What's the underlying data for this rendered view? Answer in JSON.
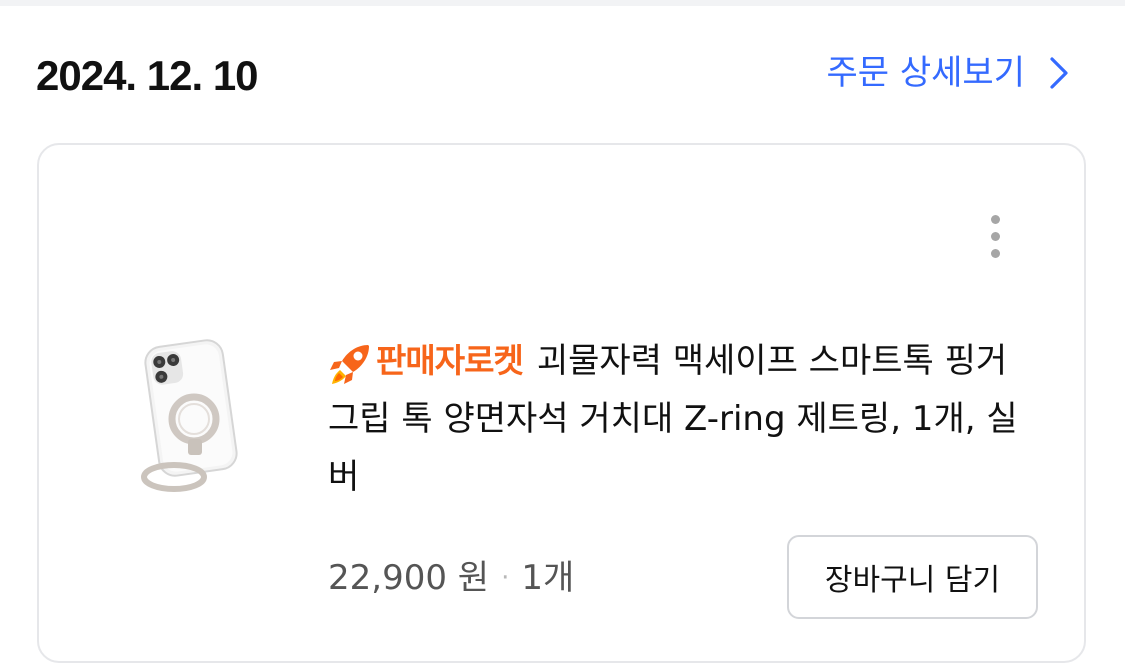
{
  "order": {
    "date": "2024. 12. 10",
    "detail_link_label": "주문 상세보기",
    "link_color": "#346aff"
  },
  "product": {
    "badge_label": "판매자로켓",
    "badge_color": "#f7651a",
    "badge_icon": "rocket-icon",
    "title": "괴물자력 맥세이프 스마트톡 핑거 그립 톡 양면자석 거치대 Z-ring 제트링, 1개, 실버",
    "price": "22,900 원",
    "separator": "·",
    "quantity": "1개",
    "thumbnail_icon": "phone-ring-product-image"
  },
  "actions": {
    "add_to_cart_label": "장바구니 담기",
    "more_icon": "kebab-menu-icon"
  }
}
